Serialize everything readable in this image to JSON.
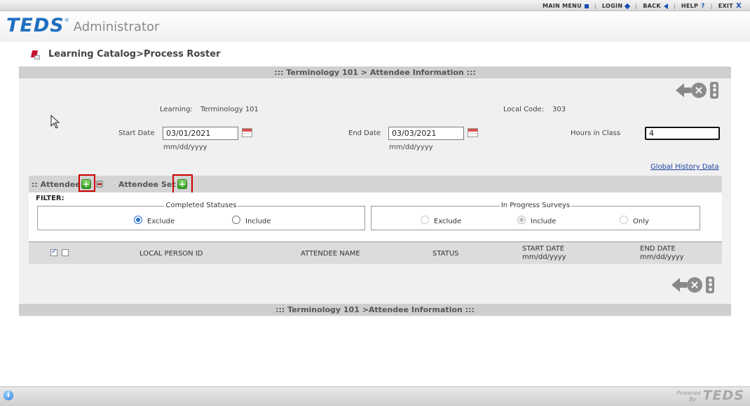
{
  "topnav": {
    "main_menu": "MAIN MENU",
    "login": "LOGIN",
    "back": "BACK",
    "help": "HELP",
    "help_glyph": "?",
    "exit": "EXIT",
    "exit_glyph": "X",
    "separator": "|"
  },
  "header": {
    "logo": "TEDS",
    "logo_reg": "®",
    "app_name": "Administrator"
  },
  "breadcrumb": {
    "text": "Learning Catalog>Process Roster"
  },
  "panel": {
    "top_title": "::: Terminology 101 > Attendee Information :::",
    "bottom_title": "::: Terminology 101 >Attendee Information :::",
    "learning_label": "Learning:",
    "learning_value": "Terminology 101",
    "local_code_label": "Local Code:",
    "local_code_value": "303",
    "start_date_label": "Start Date",
    "start_date_value": "03/01/2021",
    "start_date_hint": "mm/dd/yyyy",
    "end_date_label": "End Date",
    "end_date_value": "03/03/2021",
    "end_date_hint": "mm/dd/yyyy",
    "hours_label": "Hours in Class",
    "hours_value": "4",
    "global_history_link": "Global History Data"
  },
  "section": {
    "attendee_label": ":: Attendee",
    "attendee_set_label": "Attendee Set",
    "add_glyph": "+"
  },
  "filter": {
    "label": "FILTER:",
    "completed": {
      "legend": "Completed Statuses",
      "options": [
        "Exclude",
        "Include"
      ],
      "selected": "Exclude"
    },
    "in_progress": {
      "legend": "In Progress Surveys",
      "options": [
        "Exclude",
        "Include",
        "Only"
      ],
      "selected": "Include",
      "disabled": true
    }
  },
  "table": {
    "columns": {
      "local_person_id": "LOCAL PERSON ID",
      "attendee_name": "ATTENDEE NAME",
      "status": "STATUS",
      "start_date": "START DATE",
      "start_date_hint": "mm/dd/yyyy",
      "end_date": "END DATE",
      "end_date_hint": "mm/dd/yyyy"
    }
  },
  "footer": {
    "info_glyph": "i",
    "powered": "Powered",
    "by": "By",
    "logo": "TEDS"
  },
  "colors": {
    "accent": "#1f6fc1",
    "highlight_box": "#cc0000",
    "panel_bg": "#f0f0f0",
    "bar_bg": "#cfcfcf"
  },
  "icons": {
    "main_menu": "square-icon",
    "login": "diamond-icon",
    "back": "back-arrow-icon",
    "help": "question-icon",
    "exit": "x-icon",
    "breadcrumb": "book-icon",
    "nav_back": "back-arrow-icon",
    "nav_cancel": "cancel-icon",
    "nav_traffic": "traffic-light-icon",
    "calendar": "calendar-icon",
    "add": "add-plus-icon",
    "remove": "remove-minus-icon",
    "info": "info-icon"
  }
}
